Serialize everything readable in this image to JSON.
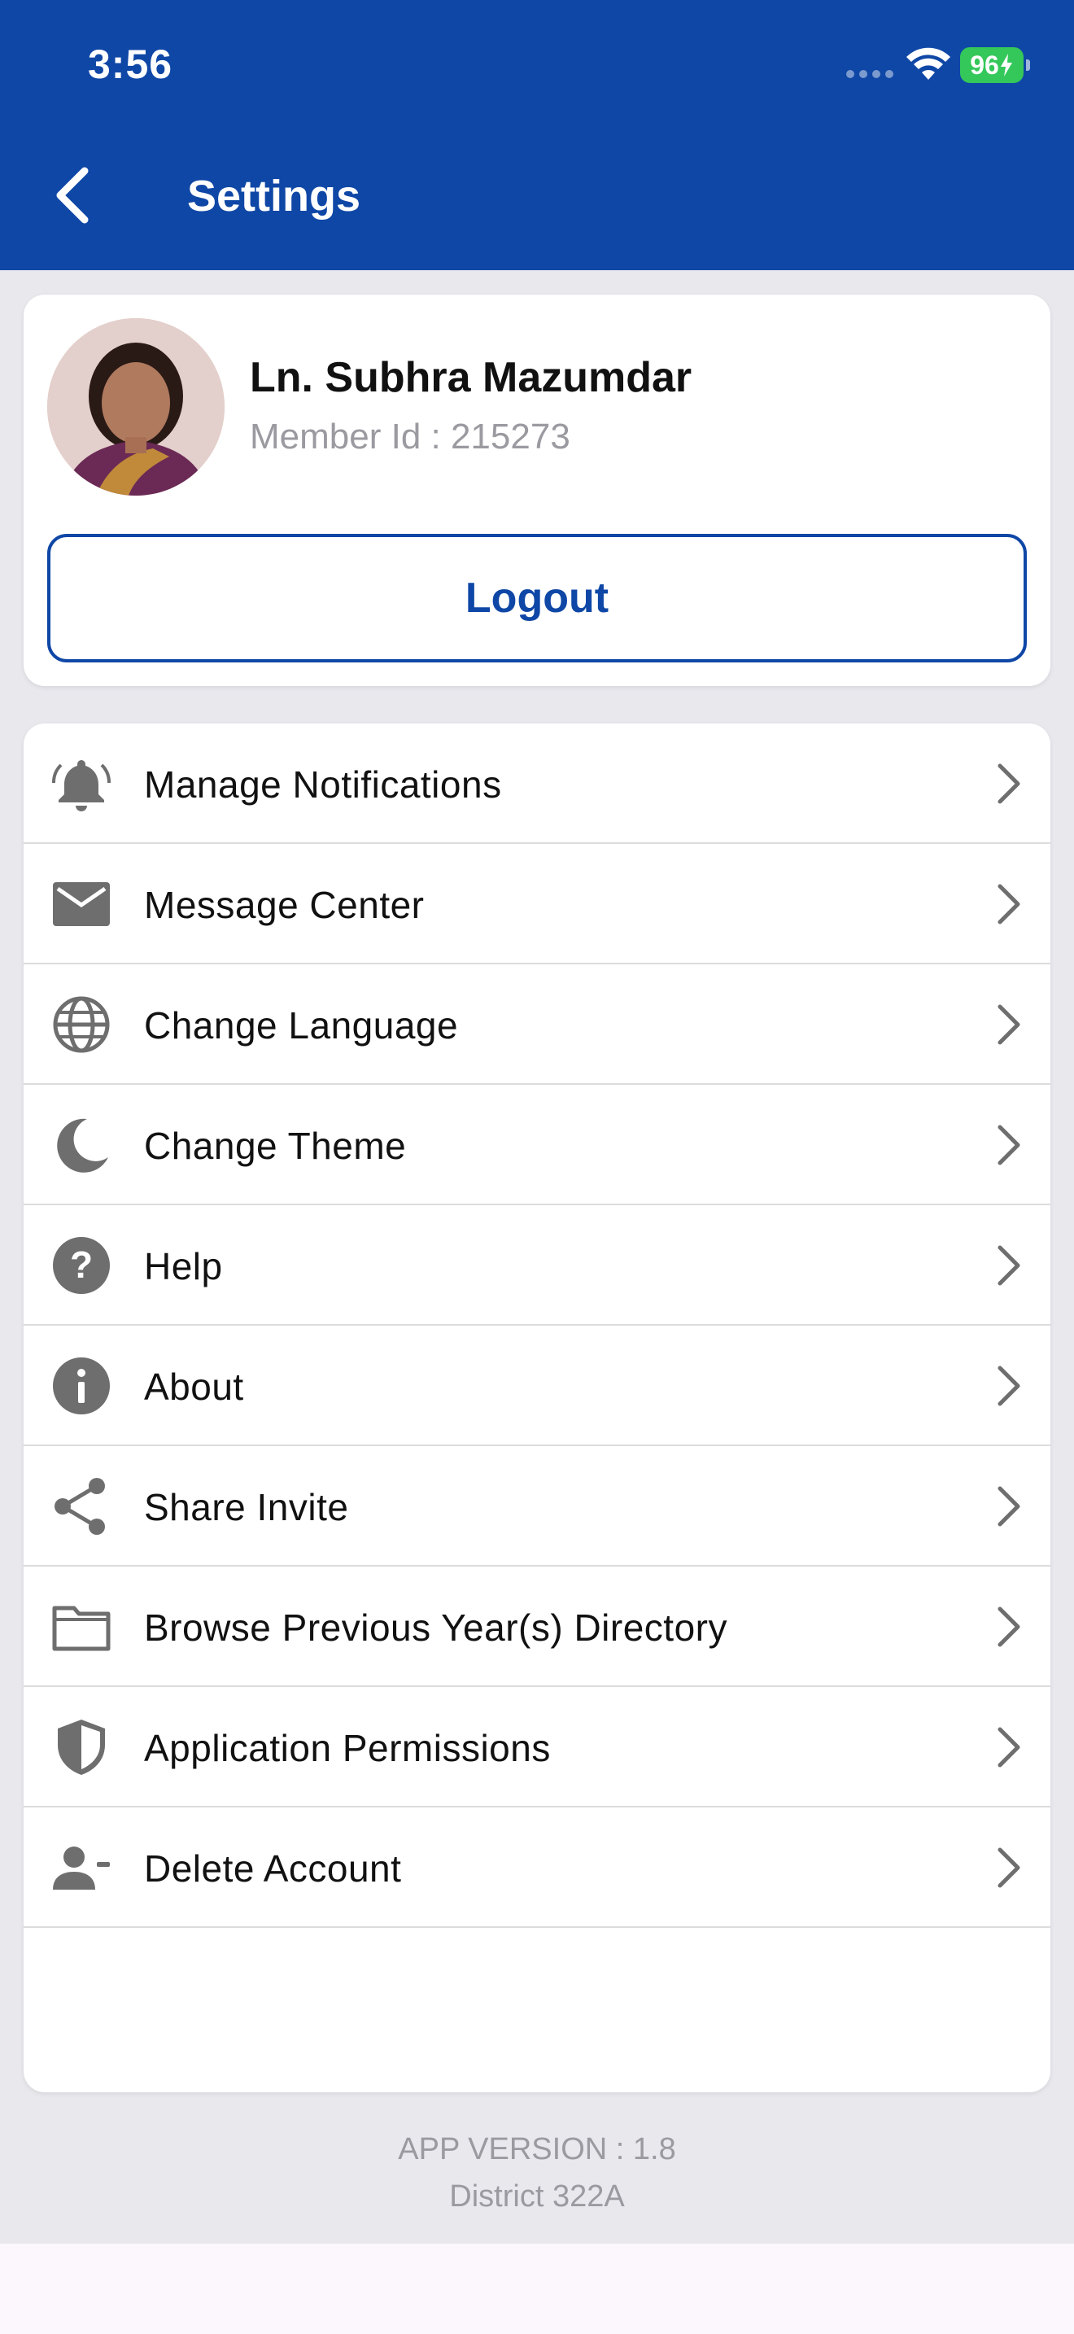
{
  "status_bar": {
    "time": "3:56",
    "battery": "96"
  },
  "app_bar": {
    "title": "Settings"
  },
  "profile": {
    "name": "Ln. Subhra Mazumdar",
    "member_id": "Member Id : 215273",
    "logout_label": "Logout"
  },
  "menu": {
    "items": [
      {
        "label": "Manage Notifications",
        "icon": "bell-icon"
      },
      {
        "label": "Message Center",
        "icon": "envelope-icon"
      },
      {
        "label": "Change Language",
        "icon": "globe-icon"
      },
      {
        "label": "Change Theme",
        "icon": "moon-icon"
      },
      {
        "label": "Help",
        "icon": "help-icon"
      },
      {
        "label": "About",
        "icon": "info-icon"
      },
      {
        "label": "Share Invite",
        "icon": "share-icon"
      },
      {
        "label": "Browse Previous Year(s) Directory",
        "icon": "folder-icon"
      },
      {
        "label": "Application Permissions",
        "icon": "shield-icon"
      },
      {
        "label": "Delete Account",
        "icon": "person-remove-icon"
      }
    ]
  },
  "footer": {
    "app_version": "APP VERSION : 1.8",
    "district": "District 322A"
  },
  "colors": {
    "primary": "#0f47a6",
    "background": "#e8e8ed",
    "icon_gray": "#6e6e6e",
    "battery_green": "#34c759"
  }
}
